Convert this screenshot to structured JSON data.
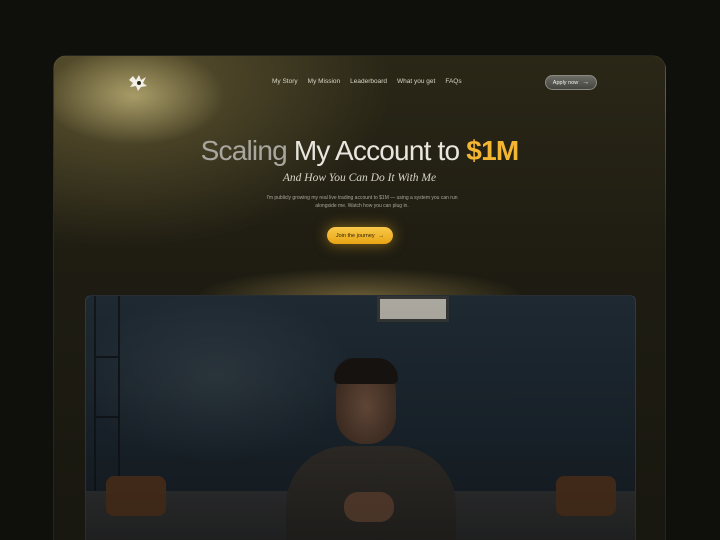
{
  "nav": {
    "items": [
      "My Story",
      "My Mission",
      "Leaderboard",
      "What you get",
      "FAQs"
    ],
    "apply_label": "Apply now"
  },
  "hero": {
    "title_part1": "Scaling",
    "title_part2": "My Account to",
    "title_highlight": "$1M",
    "subtitle": "And How You Can Do It With Me",
    "description": "I'm publicly growing my real live trading account to $1M — using a system you can run alongside me. Watch how you can plug in.",
    "cta_label": "Join the journey"
  },
  "colors": {
    "accent": "#f4b632",
    "background": "#0f0f0b"
  },
  "icons": {
    "arrow": "→"
  }
}
